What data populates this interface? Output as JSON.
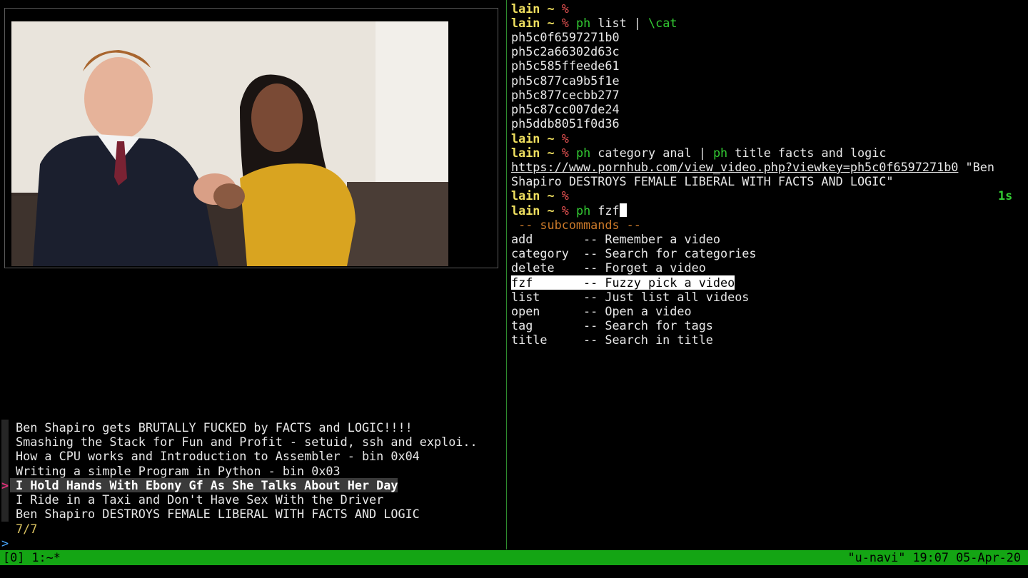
{
  "terminal": {
    "prompt_user": "lain",
    "prompt_tilde": "~",
    "prompt_sym": "%",
    "cmd_list_prog": "ph",
    "cmd_list_arg": " list | ",
    "cmd_list_cat": "\\cat",
    "ids": [
      "ph5c0f6597271b0",
      "ph5c2a66302d63c",
      "ph5c585ffeede61",
      "ph5c877ca9b5f1e",
      "ph5c877cecbb277",
      "ph5c87cc007de24",
      "ph5ddb8051f0d36"
    ],
    "cmd_cat_prog1": "ph",
    "cmd_cat_arg1": " category anal | ",
    "cmd_cat_prog2": "ph",
    "cmd_cat_arg2": " title facts and logic",
    "result_url": "https://www.pornhub.com/view_video.php?viewkey=ph5c0f6597271b0",
    "result_title_a": " \"Ben",
    "result_title_b": "Shapiro DESTROYS FEMALE LIBERAL WITH FACTS AND LOGIC\"",
    "elapsed": "1s",
    "cmd_fzf_prog": "ph",
    "cmd_fzf_arg": " fzf",
    "subcommands_header": " -- subcommands --",
    "subcommands": [
      {
        "name": "add      ",
        "desc": " -- Remember a video"
      },
      {
        "name": "category ",
        "desc": " -- Search for categories"
      },
      {
        "name": "delete   ",
        "desc": " -- Forget a video"
      },
      {
        "name": "fzf      ",
        "desc": " -- Fuzzy pick a video"
      },
      {
        "name": "list     ",
        "desc": " -- Just list all videos"
      },
      {
        "name": "open     ",
        "desc": " -- Open a video"
      },
      {
        "name": "tag      ",
        "desc": " -- Search for tags"
      },
      {
        "name": "title    ",
        "desc": " -- Search in title"
      }
    ]
  },
  "fzf": {
    "items": [
      "Ben Shapiro gets BRUTALLY FUCKED by FACTS and LOGIC!!!!",
      "Smashing the Stack for Fun and Profit - setuid, ssh and exploi..",
      "How a CPU works and Introduction to Assembler - bin 0x04",
      "Writing a simple Program in Python - bin 0x03",
      "I Hold Hands With Ebony Gf As She Talks About Her Day",
      "I Ride in a Taxi and Don't Have Sex With the Driver",
      "Ben Shapiro DESTROYS FEMALE LIBERAL WITH FACTS AND LOGIC"
    ],
    "selected_index": 4,
    "pointer": ">",
    "count": "7/7",
    "query_prompt": ">"
  },
  "status_bar": {
    "left": "[0] 1:~*",
    "right": "\"u-navi\" 19:07 05-Apr-20"
  },
  "colors": {
    "status_bg": "#14a514",
    "prompt_yellow": "#f0e060",
    "prompt_red": "#e05050",
    "command_green": "#33cc33",
    "header_orange": "#cc7a2a"
  }
}
